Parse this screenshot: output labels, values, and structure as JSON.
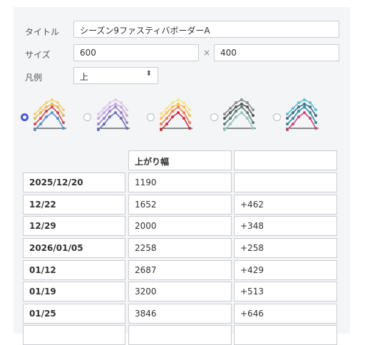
{
  "form": {
    "title_label": "タイトル",
    "title_value": "シーズン9ファスティバボーダーA",
    "size_label": "サイズ",
    "width_value": "600",
    "times_symbol": "×",
    "height_value": "400",
    "legend_label": "凡例",
    "legend_value": "上",
    "legend_caret": "⬍"
  },
  "themes": [
    {
      "name": "theme-1",
      "selected": true,
      "colors": [
        "#5a8fc7",
        "#d44a4a",
        "#e8b85a",
        "#f2d27a"
      ]
    },
    {
      "name": "theme-2",
      "selected": false,
      "colors": [
        "#6a6fb2",
        "#9b86c9",
        "#c6a9dc",
        "#e1c8ee"
      ]
    },
    {
      "name": "theme-3",
      "selected": false,
      "colors": [
        "#c8334a",
        "#ec7f56",
        "#f3c35c",
        "#f6e58a"
      ]
    },
    {
      "name": "theme-4",
      "selected": false,
      "colors": [
        "#9ac3c2",
        "#5e7f7b",
        "#565656",
        "#8f8f8f"
      ]
    },
    {
      "name": "theme-5",
      "selected": false,
      "colors": [
        "#c44a7a",
        "#3a8aa7",
        "#3c7386",
        "#61c0cf"
      ]
    }
  ],
  "table": {
    "headers": [
      "",
      "上がり幅",
      ""
    ],
    "rows": [
      [
        "2025/12/20",
        "1190",
        ""
      ],
      [
        "12/22",
        "1652",
        "+462"
      ],
      [
        "12/29",
        "2000",
        "+348"
      ],
      [
        "2026/01/05",
        "2258",
        "+258"
      ],
      [
        "01/12",
        "2687",
        "+429"
      ],
      [
        "01/19",
        "3200",
        "+513"
      ],
      [
        "01/25",
        "3846",
        "+646"
      ],
      [
        "",
        "",
        ""
      ]
    ]
  }
}
